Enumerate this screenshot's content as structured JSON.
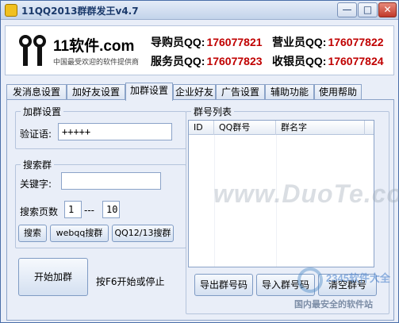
{
  "window": {
    "title": "11QQ2013群群发王v4.7",
    "minimize": "—",
    "maximize": "□",
    "close": "✕"
  },
  "banner": {
    "logo_text": "11软件.com",
    "logo_sub": "中国最受欢迎的软件提供商",
    "contacts": [
      {
        "label": "导购员QQ:",
        "number": "176077821"
      },
      {
        "label": "营业员QQ:",
        "number": "176077822"
      },
      {
        "label": "服务员QQ:",
        "number": "176077823"
      },
      {
        "label": "收银员QQ:",
        "number": "176077824"
      }
    ]
  },
  "tabs": [
    "发消息设置",
    "加好友设置",
    "加群设置",
    "企业好友",
    "广告设置",
    "辅助功能",
    "使用帮助"
  ],
  "active_tab": "加群设置",
  "add_group_settings": {
    "legend": "加群设置",
    "verify_label": "验证语:",
    "verify_value": "+++++"
  },
  "search_group": {
    "legend": "搜索群",
    "keyword_label": "关键字:",
    "keyword_value": "",
    "pages_label": "搜索页数",
    "page_from": "1",
    "page_sep": "---",
    "page_to": "10",
    "btn_search": "搜索",
    "btn_webqq": "webqq搜群",
    "btn_qq1213": "QQ12/13搜群"
  },
  "group_list": {
    "legend": "群号列表",
    "columns": [
      "ID",
      "QQ群号",
      "群名字"
    ],
    "rows": []
  },
  "actions": {
    "start": "开始加群",
    "hint": "按F6开始或停止",
    "export": "导出群号码",
    "import": "导入群号码",
    "clear": "清空群号"
  },
  "watermarks": {
    "main": "www.DuoTe.com",
    "corner_brand": "2345软件大全",
    "corner_text": "国内最安全的软件站"
  },
  "colors": {
    "accent_red": "#c00000",
    "border": "#8ba3c8",
    "title_blue": "#1b3a6b"
  }
}
